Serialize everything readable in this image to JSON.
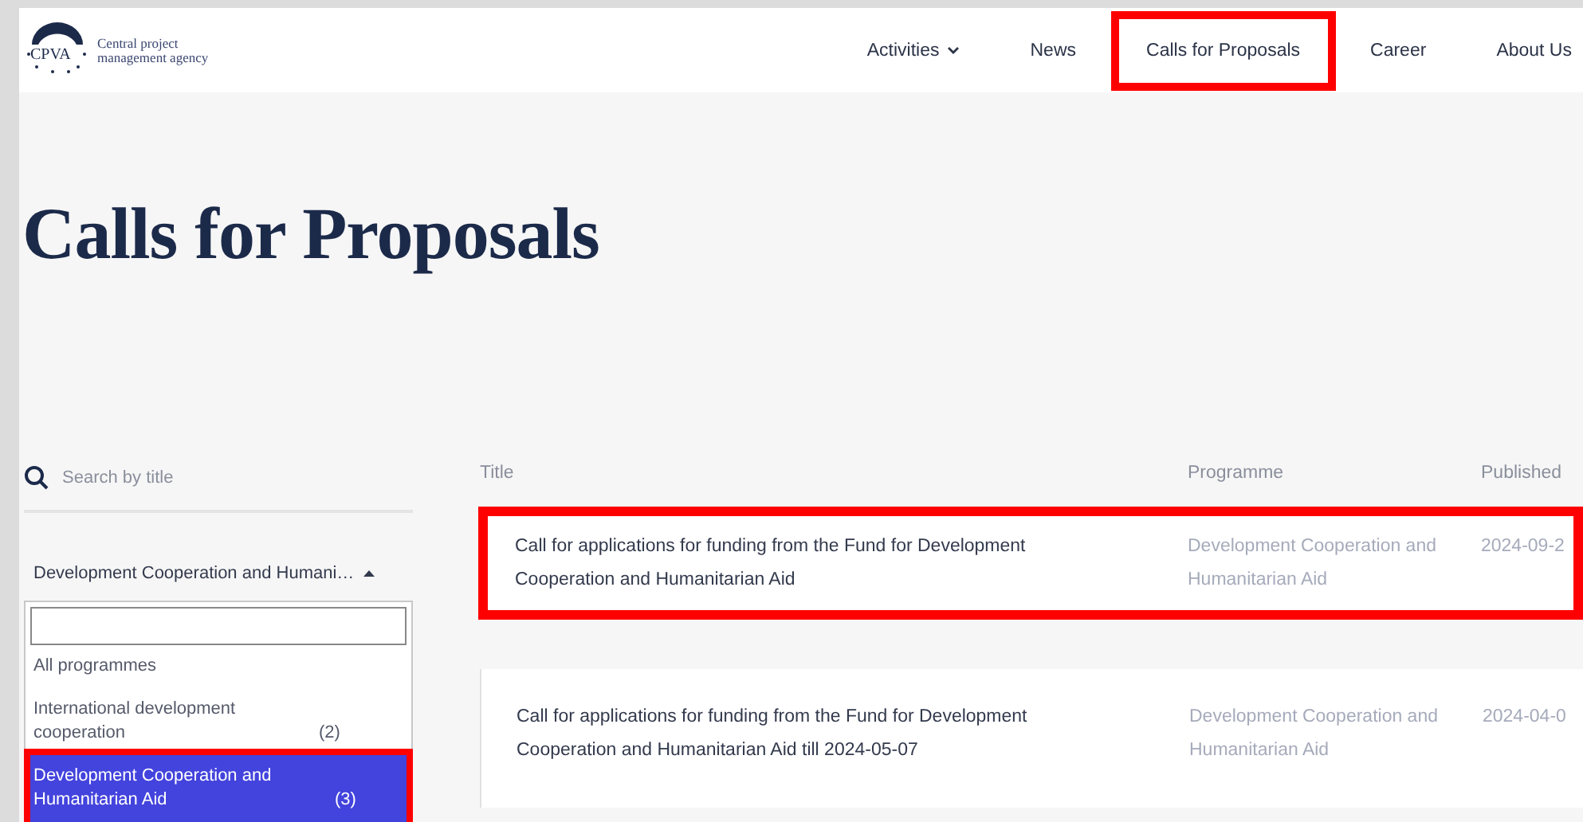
{
  "logo": {
    "mark": "CPVA",
    "name": "Central project management agency"
  },
  "nav": [
    {
      "label": "Activities",
      "has_menu": true,
      "highlighted": false
    },
    {
      "label": "News",
      "has_menu": false,
      "highlighted": false
    },
    {
      "label": "Calls for Proposals",
      "has_menu": false,
      "highlighted": true
    },
    {
      "label": "Career",
      "has_menu": false,
      "highlighted": false
    },
    {
      "label": "About Us",
      "has_menu": false,
      "highlighted": false
    }
  ],
  "page_title": "Calls for Proposals",
  "search": {
    "placeholder": "Search by title"
  },
  "programme_filter": {
    "value": "Development Cooperation and Humani…",
    "expanded": true,
    "options": [
      {
        "label": "All programmes",
        "selected": false,
        "highlighted": false
      },
      {
        "label": "International development cooperation",
        "count": "(2)",
        "selected": false,
        "highlighted": false
      },
      {
        "label": "Development Cooperation and Humanitarian Aid",
        "count": "(3)",
        "selected": true,
        "highlighted": true
      }
    ]
  },
  "table": {
    "columns": [
      "Title",
      "Programme",
      "Published"
    ],
    "rows": [
      {
        "title": "Call for applications for funding from the Fund for Development Cooperation and Humanitarian Aid",
        "programme": "Development Cooperation and Humanitarian Aid",
        "published": "2024-09-2",
        "highlighted": true
      },
      {
        "title": "Call for applications for funding from the Fund for Development Cooperation and Humanitarian Aid till 2024-05-07",
        "programme": "Development Cooperation and Humanitarian Aid",
        "published": "2024-04-0",
        "highlighted": false
      }
    ]
  }
}
